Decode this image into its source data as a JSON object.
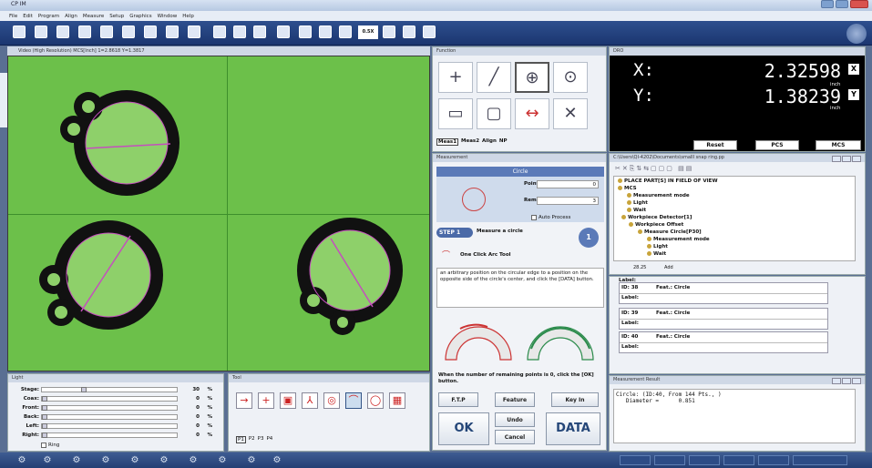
{
  "window": {
    "title": "CP IM"
  },
  "menu": [
    "File",
    "Edit",
    "Program",
    "Align",
    "Measure",
    "Setup",
    "Graphics",
    "Window",
    "Help"
  ],
  "toolbar": {
    "zoom_label": "0.5X"
  },
  "video": {
    "header": "Video (High Resolution)   MCS[Inch]  1=2.8618  Y=1.3817"
  },
  "light": {
    "header": "Light",
    "rows": [
      {
        "label": "Stage:",
        "value": "30",
        "unit": "%",
        "level": 0.3
      },
      {
        "label": "Coax:",
        "value": "0",
        "unit": "%",
        "level": 0
      },
      {
        "label": "Front:",
        "value": "0",
        "unit": "%",
        "level": 0
      },
      {
        "label": "Back:",
        "value": "0",
        "unit": "%",
        "level": 0
      },
      {
        "label": "Left:",
        "value": "0",
        "unit": "%",
        "level": 0
      },
      {
        "label": "Right:",
        "value": "0",
        "unit": "%",
        "level": 0
      }
    ],
    "ring_label": "Ring"
  },
  "tool": {
    "header": "Tool",
    "tabs": [
      "P1",
      "P2",
      "P3",
      "P4"
    ]
  },
  "function": {
    "header": "Function",
    "tabs": [
      "Meas1",
      "Meas2",
      "Align",
      "NP"
    ]
  },
  "measurement": {
    "header": "Measurement",
    "circle_title": "Circle",
    "points_label": "Points:",
    "points_value": "0",
    "remains_label": "Remains:",
    "remains_value": "3",
    "auto_process": "Auto Process",
    "step_badge": "STEP 1",
    "step_text": "Measure a circle",
    "step_number": "1",
    "arc_tool": "One Click Arc Tool",
    "description": "an arbitrary position on the circular edge to a position on the opposite side of the circle's center, and click the [DATA] button.",
    "hint": "When the number of remaining points is 0, click the [OK] button.",
    "buttons": {
      "ftp": "F.T.P",
      "feature": "Feature",
      "keyin": "Key In",
      "ok": "OK",
      "undo": "Undo",
      "cancel": "Cancel",
      "data": "DATA"
    }
  },
  "dro": {
    "header": "DRO",
    "x_label": "X:",
    "x_value": "2.32598",
    "x_unit": "inch",
    "x_btn": "X",
    "y_label": "Y:",
    "y_value": "1.38239",
    "y_unit": "inch",
    "y_btn": "Y",
    "reset": "Reset",
    "pcs": "PCS",
    "mcs": "MCS"
  },
  "program": {
    "header": "C:\\Users\\QI-4202\\Documents\\smalll snap ring.pp",
    "nodes": [
      "PLACE PART[S] IN FIELD OF VIEW",
      "MCS",
      "Measurement mode",
      "Light",
      "Wait",
      "Workpiece Detector[1]",
      "Workpiece Offset",
      "Measure Circle[P30]",
      "Measurement mode",
      "Light",
      "Wait"
    ],
    "footer_left": "28.25",
    "footer_right": "Add"
  },
  "features": {
    "header": "Label:",
    "items": [
      {
        "id": "ID: 38",
        "feat": "Feat.: Circle",
        "label": "Label:"
      },
      {
        "id": "ID: 39",
        "feat": "Feat.: Circle",
        "label": "Label:"
      },
      {
        "id": "ID: 40",
        "feat": "Feat.: Circle",
        "label": "Label:"
      }
    ]
  },
  "result": {
    "header": "Measurement Result",
    "text": "Circle: (ID:40, From 144 Pts., )\n   Diameter =      0.851"
  }
}
